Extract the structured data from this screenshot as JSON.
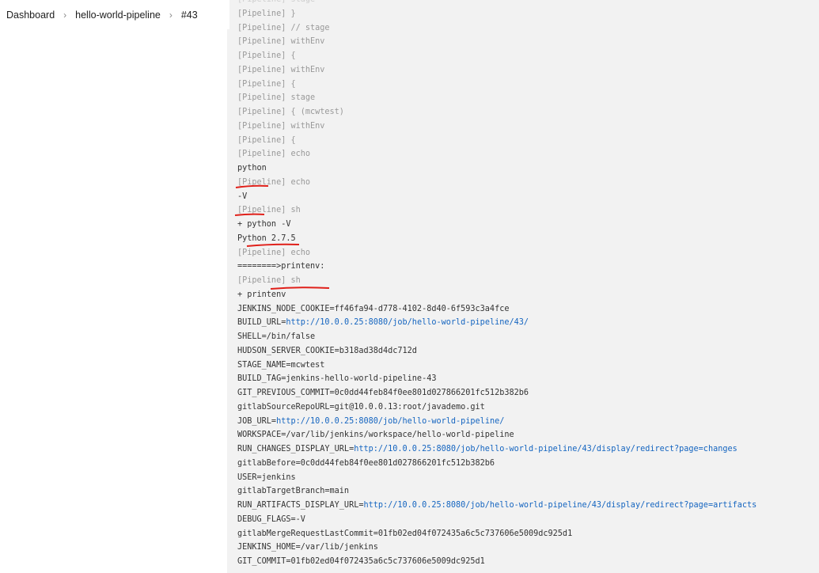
{
  "breadcrumb": [
    {
      "label": "Dashboard"
    },
    {
      "label": "hello-world-pipeline"
    },
    {
      "label": "#43"
    }
  ],
  "console": {
    "lines": [
      {
        "text": "[Pipeline] stage",
        "kind": "faded"
      },
      {
        "text": "[Pipeline] }",
        "kind": "pipeline"
      },
      {
        "text": "[Pipeline] // stage",
        "kind": "pipeline"
      },
      {
        "text": "[Pipeline] withEnv",
        "kind": "pipeline"
      },
      {
        "text": "[Pipeline] {",
        "kind": "pipeline"
      },
      {
        "text": "[Pipeline] withEnv",
        "kind": "pipeline"
      },
      {
        "text": "[Pipeline] {",
        "kind": "pipeline"
      },
      {
        "text": "[Pipeline] stage",
        "kind": "pipeline"
      },
      {
        "text": "[Pipeline] { (mcwtest)",
        "kind": "pipeline"
      },
      {
        "text": "[Pipeline] withEnv",
        "kind": "pipeline"
      },
      {
        "text": "[Pipeline] {",
        "kind": "pipeline"
      },
      {
        "text": "[Pipeline] echo",
        "kind": "pipeline"
      },
      {
        "text": "python",
        "kind": "out"
      },
      {
        "text": "[Pipeline] echo",
        "kind": "pipeline"
      },
      {
        "text": "-V",
        "kind": "out"
      },
      {
        "text": "[Pipeline] sh",
        "kind": "pipeline"
      },
      {
        "text": "+ python -V",
        "kind": "out"
      },
      {
        "text": "Python 2.7.5",
        "kind": "out"
      },
      {
        "text": "[Pipeline] echo",
        "kind": "pipeline"
      },
      {
        "text": "========>printenv:",
        "kind": "out"
      },
      {
        "text": "[Pipeline] sh",
        "kind": "pipeline"
      },
      {
        "text": "+ printenv",
        "kind": "out"
      },
      {
        "text": "JENKINS_NODE_COOKIE=ff46fa94-d778-4102-8d40-6f593c3a4fce",
        "kind": "out"
      },
      {
        "text": "BUILD_URL=",
        "link": "http://10.0.0.25:8080/job/hello-world-pipeline/43/",
        "kind": "out"
      },
      {
        "text": "SHELL=/bin/false",
        "kind": "out"
      },
      {
        "text": "HUDSON_SERVER_COOKIE=b318ad38d4dc712d",
        "kind": "out"
      },
      {
        "text": "STAGE_NAME=mcwtest",
        "kind": "out"
      },
      {
        "text": "BUILD_TAG=jenkins-hello-world-pipeline-43",
        "kind": "out"
      },
      {
        "text": "GIT_PREVIOUS_COMMIT=0c0dd44feb84f0ee801d027866201fc512b382b6",
        "kind": "out"
      },
      {
        "text": "gitlabSourceRepoURL=git@10.0.0.13:root/javademo.git",
        "kind": "out"
      },
      {
        "text": "JOB_URL=",
        "link": "http://10.0.0.25:8080/job/hello-world-pipeline/",
        "kind": "out"
      },
      {
        "text": "WORKSPACE=/var/lib/jenkins/workspace/hello-world-pipeline",
        "kind": "out"
      },
      {
        "text": "RUN_CHANGES_DISPLAY_URL=",
        "link": "http://10.0.0.25:8080/job/hello-world-pipeline/43/display/redirect?page=changes",
        "kind": "out"
      },
      {
        "text": "gitlabBefore=0c0dd44feb84f0ee801d027866201fc512b382b6",
        "kind": "out"
      },
      {
        "text": "USER=jenkins",
        "kind": "out"
      },
      {
        "text": "gitlabTargetBranch=main",
        "kind": "out"
      },
      {
        "text": "RUN_ARTIFACTS_DISPLAY_URL=",
        "link": "http://10.0.0.25:8080/job/hello-world-pipeline/43/display/redirect?page=artifacts",
        "kind": "out"
      },
      {
        "text": "DEBUG_FLAGS=-V",
        "kind": "out"
      },
      {
        "text": "gitlabMergeRequestLastCommit=01fb02ed04f072435a6c5c737606e5009dc925d1",
        "kind": "out"
      },
      {
        "text": "JENKINS_HOME=/var/lib/jenkins",
        "kind": "out"
      },
      {
        "text": "GIT_COMMIT=01fb02ed04f072435a6c5c737606e5009dc925d1",
        "kind": "out"
      }
    ]
  },
  "annotation_color": "#e0201a",
  "link_color": "#1565c0"
}
